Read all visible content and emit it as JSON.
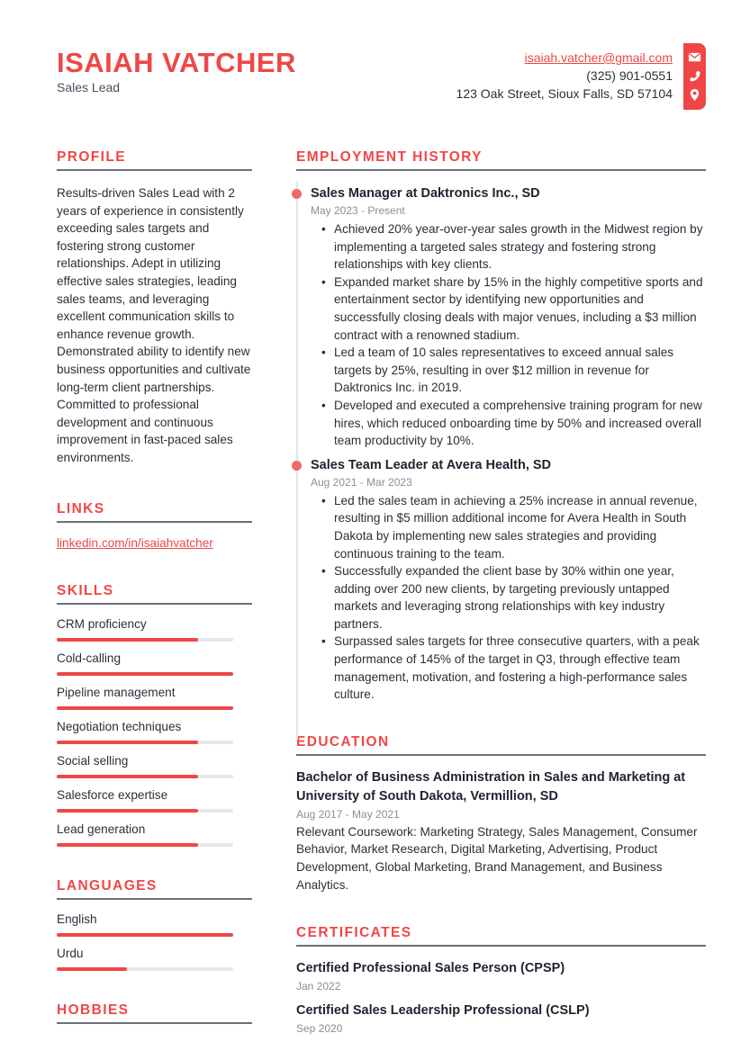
{
  "header": {
    "name": "ISAIAH VATCHER",
    "title": "Sales Lead",
    "email": "isaiah.vatcher@gmail.com",
    "phone": "(325) 901-0551",
    "address": "123 Oak Street, Sioux Falls, SD 57104",
    "icons": [
      "envelope-icon",
      "phone-icon",
      "map-pin-icon"
    ]
  },
  "colors": {
    "accent": "#ef4747",
    "text": "#2b2f3a",
    "muted": "#8a8e98",
    "rule": "#6b6f7a"
  },
  "profile": {
    "heading": "PROFILE",
    "text": "Results-driven Sales Lead with 2 years of experience in consistently exceeding sales targets and fostering strong customer relationships. Adept in utilizing effective sales strategies, leading sales teams, and leveraging excellent communication skills to enhance revenue growth. Demonstrated ability to identify new business opportunities and cultivate long-term client partnerships. Committed to professional development and continuous improvement in fast-paced sales environments."
  },
  "links": {
    "heading": "LINKS",
    "items": [
      {
        "label": "linkedin.com/in/isaiahvatcher"
      }
    ]
  },
  "skills": {
    "heading": "SKILLS",
    "items": [
      {
        "name": "CRM proficiency",
        "level": 0.8
      },
      {
        "name": "Cold-calling",
        "level": 1.0
      },
      {
        "name": "Pipeline management",
        "level": 1.0
      },
      {
        "name": "Negotiation techniques",
        "level": 0.8
      },
      {
        "name": "Social selling",
        "level": 0.8
      },
      {
        "name": "Salesforce expertise",
        "level": 0.8
      },
      {
        "name": "Lead generation",
        "level": 0.8
      }
    ]
  },
  "languages": {
    "heading": "LANGUAGES",
    "items": [
      {
        "name": "English",
        "level": 1.0
      },
      {
        "name": "Urdu",
        "level": 0.4
      }
    ]
  },
  "hobbies": {
    "heading": "HOBBIES"
  },
  "employment": {
    "heading": "EMPLOYMENT HISTORY",
    "jobs": [
      {
        "title": "Sales Manager at Daktronics Inc., SD",
        "dates": "May 2023 - Present",
        "bullets": [
          "Achieved 20% year-over-year sales growth in the Midwest region by implementing a targeted sales strategy and fostering strong relationships with key clients.",
          "Expanded market share by 15% in the highly competitive sports and entertainment sector by identifying new opportunities and successfully closing deals with major venues, including a $3 million contract with a renowned stadium.",
          "Led a team of 10 sales representatives to exceed annual sales targets by 25%, resulting in over $12 million in revenue for Daktronics Inc. in 2019.",
          "Developed and executed a comprehensive training program for new hires, which reduced onboarding time by 50% and increased overall team productivity by 10%."
        ]
      },
      {
        "title": "Sales Team Leader at Avera Health, SD",
        "dates": "Aug 2021 - Mar 2023",
        "bullets": [
          "Led the sales team in achieving a 25% increase in annual revenue, resulting in $5 million additional income for Avera Health in South Dakota by implementing new sales strategies and providing continuous training to the team.",
          "Successfully expanded the client base by 30% within one year, adding over 200 new clients, by targeting previously untapped markets and leveraging strong relationships with key industry partners.",
          "Surpassed sales targets for three consecutive quarters, with a peak performance of 145% of the target in Q3, through effective team management, motivation, and fostering a high-performance sales culture."
        ]
      }
    ]
  },
  "education": {
    "heading": "EDUCATION",
    "items": [
      {
        "title": "Bachelor of Business Administration in Sales and Marketing at University of South Dakota, Vermillion, SD",
        "dates": "Aug 2017 - May 2021",
        "description": "Relevant Coursework: Marketing Strategy, Sales Management, Consumer Behavior, Market Research, Digital Marketing, Advertising, Product Development, Global Marketing, Brand Management, and Business Analytics."
      }
    ]
  },
  "certificates": {
    "heading": "CERTIFICATES",
    "items": [
      {
        "title": "Certified Professional Sales Person (CPSP)",
        "date": "Jan 2022"
      },
      {
        "title": "Certified Sales Leadership Professional (CSLP)",
        "date": "Sep 2020"
      }
    ]
  }
}
